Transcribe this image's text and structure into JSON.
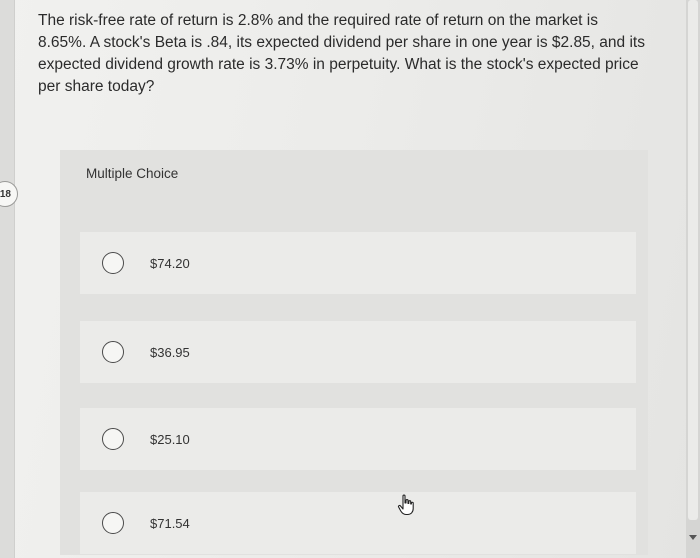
{
  "question": {
    "number": "18",
    "text": "The risk-free rate of return is 2.8% and the required rate of return on the market is 8.65%. A stock's Beta is .84, its expected dividend per share in one year is $2.85, and its expected dividend growth rate is 3.73% in perpetuity. What is the stock's expected price per share today?"
  },
  "multiple_choice": {
    "label": "Multiple Choice",
    "options": [
      {
        "label": "$74.20"
      },
      {
        "label": "$36.95"
      },
      {
        "label": "$25.10"
      },
      {
        "label": "$71.54"
      }
    ]
  },
  "icons": {
    "cursor": "hand-pointer-icon",
    "radio": "radio-button-icon"
  }
}
